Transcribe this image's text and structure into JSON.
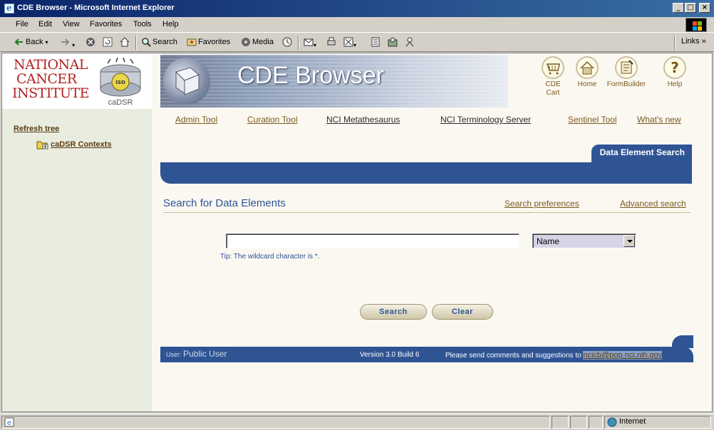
{
  "window": {
    "title": "CDE Browser - Microsoft Internet Explorer",
    "minimize": "_",
    "maximize": "□",
    "close": "×"
  },
  "menu": {
    "file": "File",
    "edit": "Edit",
    "view": "View",
    "favorites": "Favorites",
    "tools": "Tools",
    "help": "Help"
  },
  "toolbar": {
    "back": "Back",
    "search": "Search",
    "favorites": "Favorites",
    "media": "Media",
    "links": "Links"
  },
  "left": {
    "logo_text": "NATIONAL CANCER INSTITUTE",
    "cadsr_label": "caDSR",
    "iso_label": "ISO",
    "refresh": "Refresh tree",
    "contexts": "caDSR Contexts"
  },
  "banner": {
    "title": "CDE Browser"
  },
  "top_icons": {
    "cart": "CDE Cart",
    "home": "Home",
    "formbuilder": "FormBuilder",
    "help": "Help",
    "help_glyph": "?"
  },
  "nav": {
    "admin": "Admin Tool",
    "curation": "Curation Tool",
    "metathesaurus": "NCI Metathesaurus",
    "terminology": "NCI Terminology Server",
    "sentinel": "Sentinel Tool",
    "whatsnew": "What's new"
  },
  "tab": {
    "label": "Data Element Search"
  },
  "search": {
    "title": "Search for Data Elements",
    "preferences": "Search preferences",
    "advanced": "Advanced search",
    "input_value": "",
    "select_value": "Name",
    "tip": "Tip: The wildcard character is *.",
    "search_button": "Search",
    "clear_button": "Clear"
  },
  "footer": {
    "user_label": "User:",
    "user_name": "Public User",
    "version": "Version 3.0  Build 6",
    "comments": "Please send comments and suggestions to",
    "email": "ncicb@pop.nci.nih.gov"
  },
  "status": {
    "zone": "Internet"
  }
}
